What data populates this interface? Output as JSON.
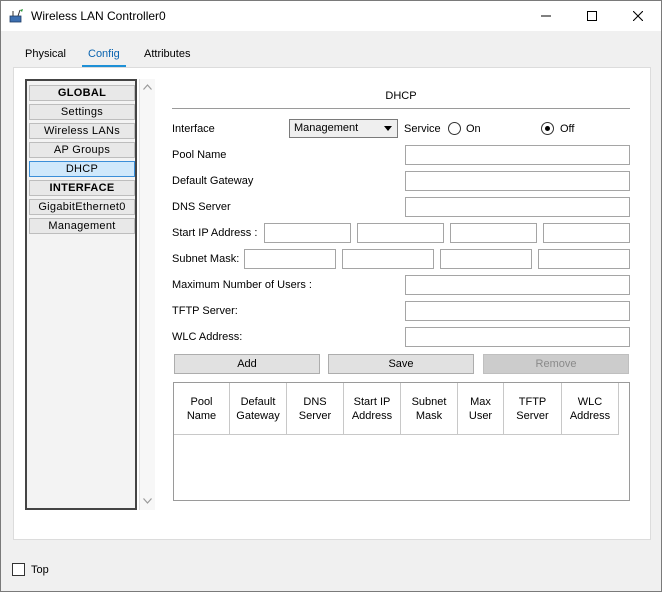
{
  "window": {
    "title": "Wireless LAN Controller0",
    "app_icon": "router-wireless-icon",
    "controls": [
      "minimize-icon",
      "maximize-icon",
      "close-icon"
    ]
  },
  "tabs": [
    {
      "label": "Physical",
      "active": false
    },
    {
      "label": "Config",
      "active": true
    },
    {
      "label": "Attributes",
      "active": false
    }
  ],
  "sidebar": {
    "items": [
      {
        "label": "GLOBAL",
        "type": "header"
      },
      {
        "label": "Settings",
        "type": "item"
      },
      {
        "label": "Wireless LANs",
        "type": "item"
      },
      {
        "label": "AP Groups",
        "type": "item"
      },
      {
        "label": "DHCP",
        "type": "item",
        "selected": true
      },
      {
        "label": "INTERFACE",
        "type": "header"
      },
      {
        "label": "GigabitEthernet0",
        "type": "item"
      },
      {
        "label": "Management",
        "type": "item"
      }
    ]
  },
  "dhcp": {
    "section_title": "DHCP",
    "interface_label": "Interface",
    "interface_value": "Management",
    "service_label": "Service",
    "service_on_label": "On",
    "service_off_label": "Off",
    "service_value": "Off",
    "pool_name_label": "Pool Name",
    "default_gateway_label": "Default Gateway",
    "dns_server_label": "DNS Server",
    "start_ip_label": "Start IP Address :",
    "subnet_mask_label": "Subnet Mask:",
    "max_users_label": "Maximum Number of Users :",
    "tftp_label": "TFTP Server:",
    "wlc_label": "WLC Address:",
    "buttons": {
      "add": "Add",
      "save": "Save",
      "remove": "Remove"
    },
    "columns": [
      "Pool Name",
      "Default Gateway",
      "DNS Server",
      "Start IP Address",
      "Subnet Mask",
      "Max User",
      "TFTP Server",
      "WLC Address"
    ]
  },
  "footer": {
    "top_label": "Top",
    "top_checked": false
  }
}
